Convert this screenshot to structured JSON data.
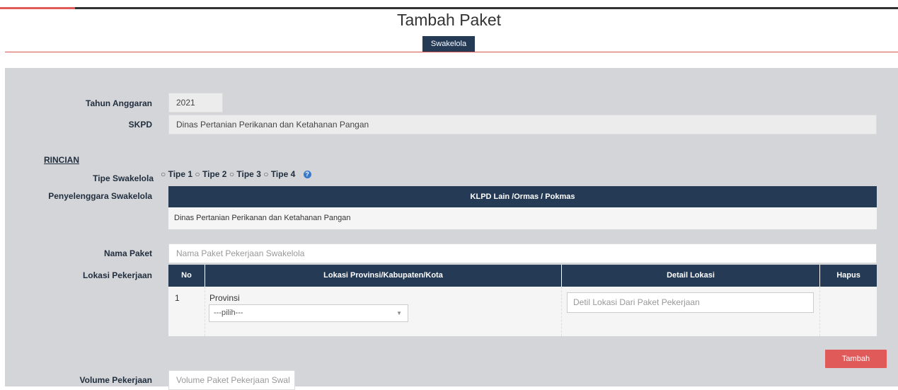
{
  "page": {
    "title": "Tambah Paket",
    "tab_label": "Swakelola"
  },
  "form": {
    "tahun_anggaran": {
      "label": "Tahun Anggaran",
      "value": "2021"
    },
    "skpd": {
      "label": "SKPD",
      "value": "Dinas Pertanian Perikanan dan Ketahanan Pangan"
    },
    "rincian_label": "RINCIAN",
    "tipe_swakelola": {
      "label": "Tipe Swakelola",
      "options": [
        "Tipe 1",
        "Tipe 2",
        "Tipe 3",
        "Tipe 4"
      ],
      "help_icon": "question-circle-icon"
    },
    "penyelenggara": {
      "label": "Penyelenggara Swakelola",
      "header": "KLPD Lain /Ormas / Pokmas",
      "value": "Dinas Pertanian Perikanan dan Ketahanan Pangan"
    },
    "nama_paket": {
      "label": "Nama Paket",
      "placeholder": "Nama Paket Pekerjaan Swakelola"
    },
    "lokasi": {
      "label": "Lokasi Pekerjaan",
      "columns": [
        "No",
        "Lokasi Provinsi/Kabupaten/Kota",
        "Detail Lokasi",
        "Hapus"
      ],
      "rows": [
        {
          "no": "1",
          "provinsi_label": "Provinsi",
          "provinsi_select": "---pilih---",
          "detail_placeholder": "Detil Lokasi Dari Paket Pekerjaan"
        }
      ],
      "add_button": "Tambah"
    },
    "volume": {
      "label": "Volume Pekerjaan",
      "placeholder": "Volume Paket Pekerjaan Swal"
    }
  },
  "colors": {
    "header_navy": "#253a55",
    "accent_red": "#e05a5a",
    "panel_gray": "#d4d5d8"
  }
}
